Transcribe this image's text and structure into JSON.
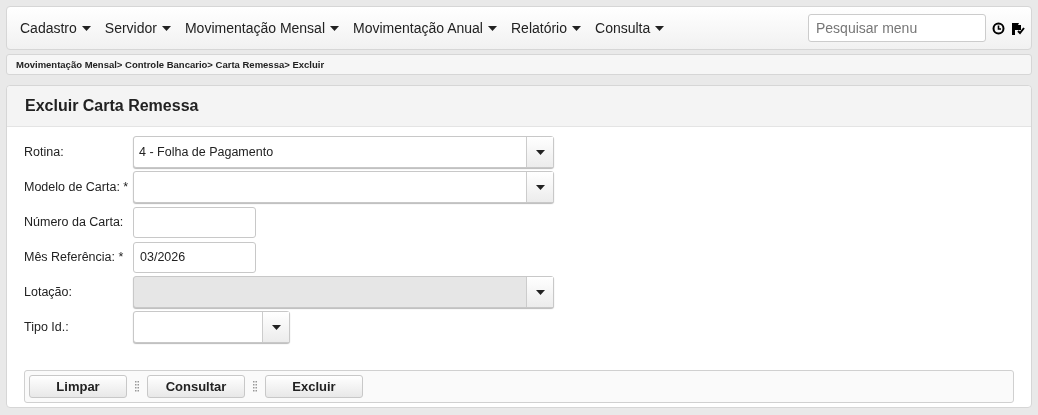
{
  "menu": [
    {
      "label": "Cadastro"
    },
    {
      "label": "Servidor"
    },
    {
      "label": "Movimentação Mensal"
    },
    {
      "label": "Movimentação Anual"
    },
    {
      "label": "Relatório"
    },
    {
      "label": "Consulta"
    }
  ],
  "search": {
    "placeholder": "Pesquisar menu"
  },
  "breadcrumb": "Movimentação Mensal> Controle Bancario> Carta Remessa> Excluir",
  "form": {
    "title": "Excluir Carta Remessa",
    "fields": [
      {
        "label": "Rotina:",
        "kind": "select",
        "value": "4 - Folha de Pagamento",
        "disabled": false
      },
      {
        "label": "Modelo de Carta: *",
        "kind": "select",
        "disabled": false
      },
      {
        "label": "Número da Carta:",
        "kind": "text",
        "disabled": false
      },
      {
        "label": "Mês Referência: *",
        "kind": "text",
        "value": "03/2026",
        "disabled": false
      },
      {
        "label": "Lotação:",
        "kind": "select",
        "disabled": true
      },
      {
        "label": "Tipo Id.:",
        "kind": "short-select",
        "disabled": false
      }
    ],
    "buttons": [
      "Limpar",
      "Consultar",
      "Excluir"
    ]
  }
}
